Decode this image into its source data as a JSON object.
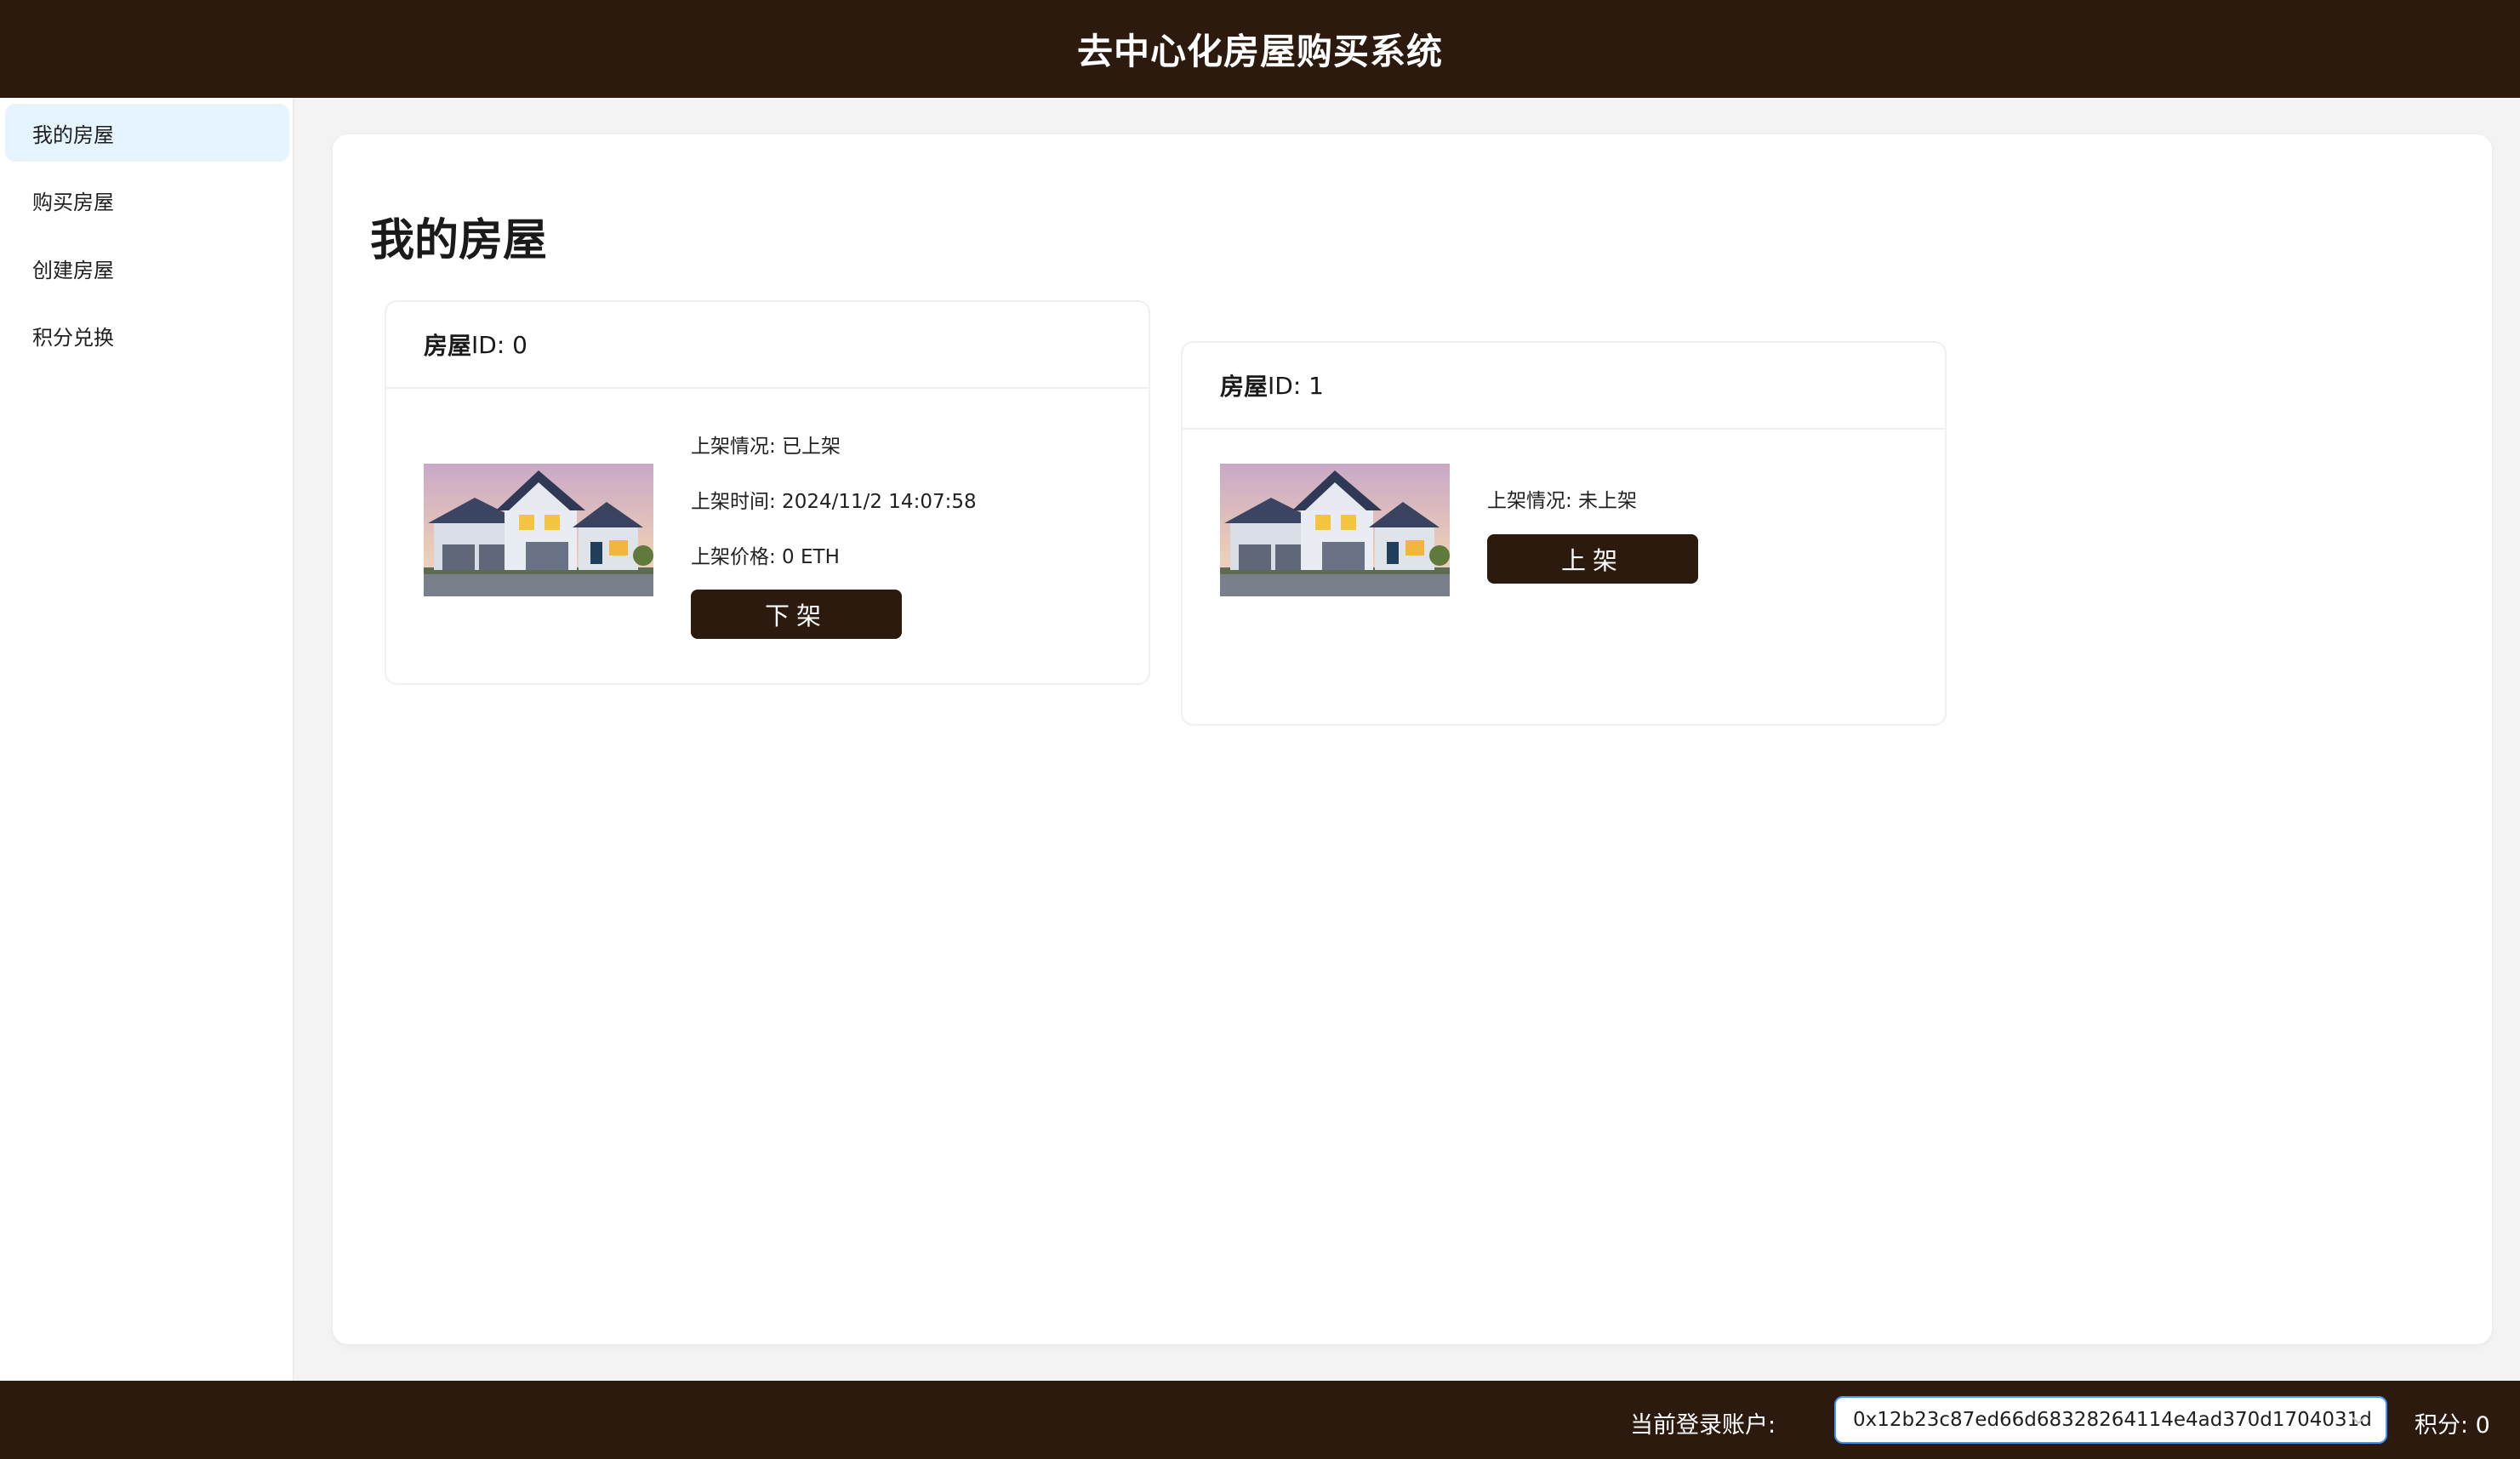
{
  "header": {
    "title": "去中心化房屋购买系统"
  },
  "sidebar": {
    "items": [
      {
        "label": "我的房屋",
        "active": true
      },
      {
        "label": "购买房屋",
        "active": false
      },
      {
        "label": "创建房屋",
        "active": false
      },
      {
        "label": "积分兑换",
        "active": false
      }
    ]
  },
  "main": {
    "title": "我的房屋",
    "houses": [
      {
        "id_prefix": "房屋",
        "id_rest": "ID: 0",
        "status": "上架情况: 已上架",
        "time": "上架时间: 2024/11/2 14:07:58",
        "price": "上架价格: 0 ETH",
        "button": "下架"
      },
      {
        "id_prefix": "房屋",
        "id_rest": "ID: 1",
        "status": "上架情况: 未上架",
        "button": "上架"
      }
    ]
  },
  "footer": {
    "account_label": "当前登录账户:",
    "account_value": "0x12b23c87ed66d68328264114e4ad370d1704031d",
    "points": "积分: 0"
  },
  "colors": {
    "brand": "#2c1a0e",
    "active_menu_bg": "#e6f4ff",
    "select_border": "#4096ff"
  }
}
